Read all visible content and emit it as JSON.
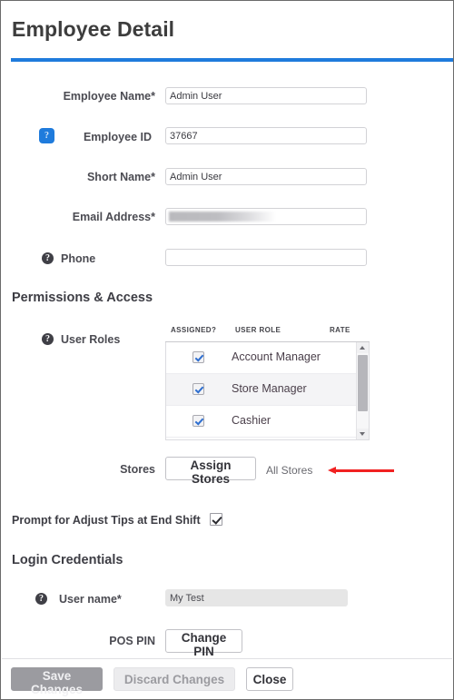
{
  "window": {
    "title": "Employee Detail",
    "accent_color": "#1f7bdc",
    "border_color": "#6b6b6b"
  },
  "fields": [
    {
      "label": "Employee Name*",
      "value": "Admin User",
      "help_icon": null,
      "state": "editable"
    },
    {
      "label": "Employee ID",
      "value": "37667",
      "help_icon": "help-icon",
      "help_state": "selected",
      "state": "editable"
    },
    {
      "label": "Short Name*",
      "value": "Admin User",
      "help_icon": null,
      "state": "editable"
    },
    {
      "label": "Email Address*",
      "value": "",
      "help_icon": null,
      "state": "redacted"
    },
    {
      "label": "Phone",
      "value": "",
      "help_icon": "help-icon",
      "help_state": "normal",
      "state": "editable"
    }
  ],
  "permissions": {
    "heading": "Permissions & Access",
    "user_roles": {
      "label": "User Roles",
      "help_icon": "help-icon",
      "columns": [
        "ASSIGNED?",
        "USER ROLE",
        "RATE"
      ],
      "rows": [
        {
          "assigned": true,
          "role": "Account Manager",
          "rate": ""
        },
        {
          "assigned": true,
          "role": "Store Manager",
          "rate": ""
        },
        {
          "assigned": true,
          "role": "Cashier",
          "rate": ""
        }
      ],
      "scrollbar": {
        "up_icon": "chevron-up-icon",
        "down_icon": "chevron-down-icon"
      }
    },
    "stores": {
      "label": "Stores",
      "button_label": "Assign Stores",
      "value_text": "All Stores",
      "annotation": {
        "type": "arrow",
        "direction": "left",
        "color": "#f12121"
      }
    },
    "prompt_tips": {
      "label": "Prompt for Adjust Tips at End Shift",
      "checked": true
    }
  },
  "login": {
    "heading": "Login Credentials",
    "username": {
      "label": "User name*",
      "value": "My Test",
      "help_icon": "help-icon",
      "state": "disabled"
    },
    "pos_pin": {
      "label": "POS PIN",
      "button_label": "Change PIN"
    }
  },
  "footer": {
    "save_label": "Save Changes",
    "save_enabled": false,
    "discard_label": "Discard Changes",
    "discard_enabled": false,
    "close_label": "Close",
    "close_enabled": true
  }
}
